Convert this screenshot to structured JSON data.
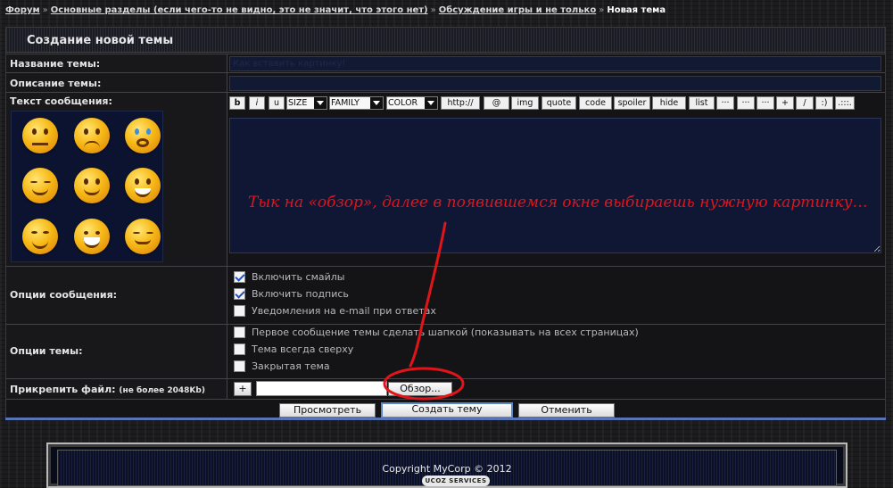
{
  "breadcrumb": {
    "items": [
      "Форум",
      "Основные разделы (если чего-то не видно, это не значит, что этого нет)",
      "Обсуждение игры и не только"
    ],
    "separator": "»",
    "current": "Новая тема"
  },
  "panel": {
    "title": "Создание новой темы"
  },
  "form": {
    "topic_label": "Название темы:",
    "topic_value": "Как вставить картинку!",
    "description_label": "Описание темы:",
    "description_value": "",
    "message_label": "Текст сообщения:",
    "message_options_label": "Опции сообщения:",
    "topic_options_label": "Опции темы:",
    "attach_label": "Прикрепить файл:",
    "attach_note": "(не более 2048Kb)"
  },
  "toolbar": {
    "bold": "b",
    "italic": "i",
    "underline": "u",
    "size": "SIZE",
    "family": "FAMILY",
    "color": "COLOR",
    "http": "http://",
    "at": "@",
    "img": "img",
    "quote": "quote",
    "code": "code",
    "spoiler": "spoiler",
    "hide": "hide",
    "list": "list",
    "dots1": "···",
    "dots2": "···",
    "dots3": "···",
    "plus": "+",
    "slash": "/",
    "smile": ":)",
    "more": ".:::."
  },
  "message_options": [
    {
      "label": "Включить смайлы",
      "checked": true
    },
    {
      "label": "Включить подпись",
      "checked": true
    },
    {
      "label": "Уведомления на e-mail при ответах",
      "checked": false
    }
  ],
  "topic_options": [
    {
      "label": "Первое сообщение темы сделать шапкой (показывать на всех страницах)",
      "checked": false
    },
    {
      "label": "Тема всегда сверху",
      "checked": false
    },
    {
      "label": "Закрытая тема",
      "checked": false
    }
  ],
  "attach": {
    "add": "+",
    "browse": "Обзор..."
  },
  "actions": {
    "preview": "Просмотреть",
    "create": "Создать тему",
    "cancel": "Отменить"
  },
  "annotation": "Тык на «обзор», далее в появившемся окне выбираешь нужную картинку…",
  "footer": {
    "copyright": "Copyright MyCorp © 2012",
    "badge": "UCOZ SERVICES"
  },
  "smileys": [
    "blank-face-icon",
    "sweat-face-icon",
    "crying-face-icon",
    "wink-face-icon",
    "smile-face-icon",
    "grin-face-icon",
    "laugh-face-icon",
    "big-grin-face-icon",
    "squint-face-icon"
  ],
  "colors": {
    "annotation": "#e0141a",
    "input_bg": "#121a33",
    "accent_line": "#5874b4"
  }
}
